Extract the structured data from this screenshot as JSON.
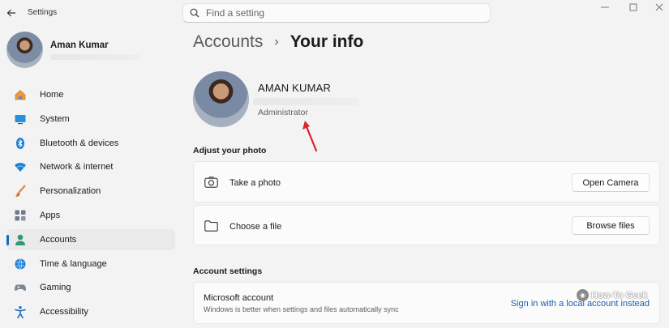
{
  "app": {
    "title": "Settings"
  },
  "search": {
    "placeholder": "Find a setting"
  },
  "profile": {
    "name": "Aman Kumar"
  },
  "nav": {
    "items": [
      {
        "label": "Home",
        "icon": "home-icon"
      },
      {
        "label": "System",
        "icon": "system-icon"
      },
      {
        "label": "Bluetooth & devices",
        "icon": "bluetooth-icon"
      },
      {
        "label": "Network & internet",
        "icon": "wifi-icon"
      },
      {
        "label": "Personalization",
        "icon": "brush-icon"
      },
      {
        "label": "Apps",
        "icon": "apps-icon"
      },
      {
        "label": "Accounts",
        "icon": "accounts-icon",
        "active": true
      },
      {
        "label": "Time & language",
        "icon": "globe-icon"
      },
      {
        "label": "Gaming",
        "icon": "gamepad-icon"
      },
      {
        "label": "Accessibility",
        "icon": "accessibility-icon"
      }
    ]
  },
  "breadcrumb": {
    "parent": "Accounts",
    "separator": "›",
    "current": "Your info"
  },
  "user": {
    "name": "AMAN KUMAR",
    "role": "Administrator"
  },
  "adjust_photo": {
    "heading": "Adjust your photo",
    "take_photo": {
      "label": "Take a photo",
      "button": "Open Camera"
    },
    "choose_file": {
      "label": "Choose a file",
      "button": "Browse files"
    }
  },
  "account_settings": {
    "heading": "Account settings",
    "microsoft": {
      "title": "Microsoft account",
      "subtitle": "Windows is better when settings and files automatically sync",
      "link": "Sign in with a local account instead"
    }
  },
  "watermark": {
    "text": "How-To Geek"
  },
  "colors": {
    "accent": "#0f6cbd",
    "link": "#1b61b0",
    "arrow": "#d8262b"
  }
}
